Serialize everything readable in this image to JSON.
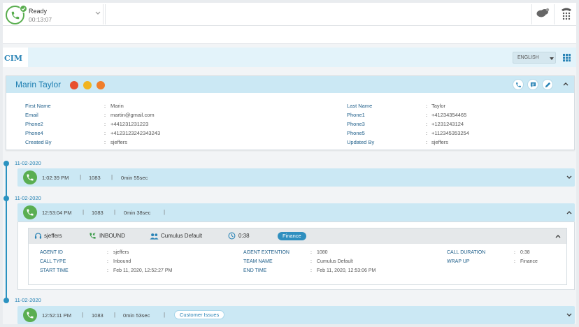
{
  "status": {
    "label": "Ready",
    "timer": "00:13:07"
  },
  "cim": {
    "logo": "CIM",
    "language": "ENGLISH"
  },
  "profile": {
    "name": "Marin Taylor",
    "fields": [
      {
        "label": "First Name",
        "value": "Marin"
      },
      {
        "label": "Email",
        "value": "martin@gmail.com"
      },
      {
        "label": "Phone2",
        "value": "+441231231223"
      },
      {
        "label": "Phone4",
        "value": "+4123123242343243"
      },
      {
        "label": "Created By",
        "value": "sjeffers"
      },
      {
        "label": "Last Name",
        "value": "Taylor"
      },
      {
        "label": "Phone1",
        "value": "+41234354465"
      },
      {
        "label": "Phone3",
        "value": "+1231243124"
      },
      {
        "label": "Phone5",
        "value": "+112345353254"
      },
      {
        "label": "Updated By",
        "value": "sjeffers"
      }
    ],
    "dot_colors": [
      "#e8502f",
      "#f2b41f",
      "#f07e2b"
    ]
  },
  "timeline": [
    {
      "date": "11-02-2020",
      "time": "1:02:39 PM",
      "extension": "1083",
      "duration": "0min 55sec",
      "tag": ""
    },
    {
      "date": "11-02-2020",
      "time": "12:53:04 PM",
      "extension": "1083",
      "duration": "0min 38sec",
      "tag": ""
    },
    {
      "date": "11-02-2020",
      "time": "12:52:11 PM",
      "extension": "1083",
      "duration": "0min 53sec",
      "tag": "Customer Issues"
    }
  ],
  "separator": "|",
  "call_detail": {
    "agent": "sjeffers",
    "direction": "INBOUND",
    "team": "Cumulus Default",
    "handle_time": "0:38",
    "queue": "Finance",
    "fields": [
      {
        "label": "AGENT ID",
        "value": "sjeffers"
      },
      {
        "label": "CALL TYPE",
        "value": "Inbound"
      },
      {
        "label": "START TIME",
        "value": "Feb 11, 2020, 12:52:27 PM"
      },
      {
        "label": "AGENT EXTENTION",
        "value": "1080"
      },
      {
        "label": "TEAM NAME",
        "value": "Cumulus Default"
      },
      {
        "label": "END TIME",
        "value": "Feb 11, 2020, 12:53:06 PM"
      },
      {
        "label": "CALL DURATION",
        "value": "0:38"
      },
      {
        "label": "WRAP UP",
        "value": "Finance"
      }
    ]
  },
  "colors": {
    "accent": "#2a84b6",
    "ready_green": "#58ad4e",
    "header_blue": "#cbe8f4"
  },
  "icons": [
    "phone-icon",
    "check-icon",
    "chevron-down-icon",
    "chat-icon",
    "dialpad-icon",
    "apps-grid-icon",
    "message-icon",
    "edit-icon",
    "chevron-up-icon",
    "headset-icon",
    "inbound-call-icon",
    "team-icon",
    "clock-icon"
  ]
}
